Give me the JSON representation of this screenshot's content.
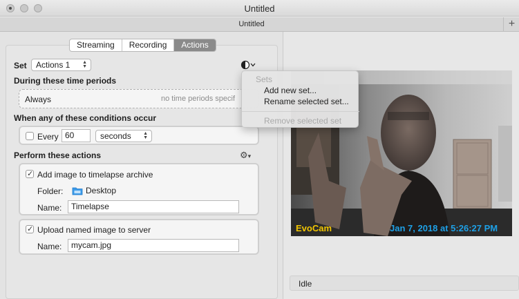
{
  "window": {
    "title": "Untitled",
    "tab_title": "Untitled",
    "new_tab_label": "+"
  },
  "segments": [
    {
      "label": "Streaming",
      "active": false
    },
    {
      "label": "Recording",
      "active": false
    },
    {
      "label": "Actions",
      "active": true
    }
  ],
  "set": {
    "label": "Set",
    "value": "Actions 1"
  },
  "time_periods": {
    "heading": "During these time periods",
    "value": "Always",
    "hint": "no time periods specif"
  },
  "conditions": {
    "heading": "When any of these conditions occur",
    "every_label": "Every",
    "every_checked": false,
    "interval": "60",
    "unit": "seconds"
  },
  "actions": {
    "heading": "Perform these actions",
    "timelapse": {
      "label": "Add image to timelapse archive",
      "checked": true,
      "folder_label": "Folder:",
      "folder_value": "Desktop",
      "name_label": "Name:",
      "name_value": "Timelapse"
    },
    "upload": {
      "label": "Upload named image to server",
      "checked": true,
      "name_label": "Name:",
      "name_value": "mycam.jpg"
    }
  },
  "menu": {
    "header": "Sets",
    "items": [
      {
        "label": "Add new set...",
        "enabled": true
      },
      {
        "label": "Rename selected set...",
        "enabled": true
      },
      {
        "label": "Remove selected set",
        "enabled": false
      }
    ]
  },
  "preview": {
    "overlay_brand": "EvoCam",
    "overlay_timestamp": "Jan 7, 2018 at 5:26:27 PM",
    "brand_color": "#f2c500",
    "timestamp_color": "#1ea0e6"
  },
  "status": {
    "text": "Idle"
  },
  "icons": {
    "appearance": "half-circle-icon",
    "gear": "gear-icon",
    "folder": "folder-icon"
  }
}
